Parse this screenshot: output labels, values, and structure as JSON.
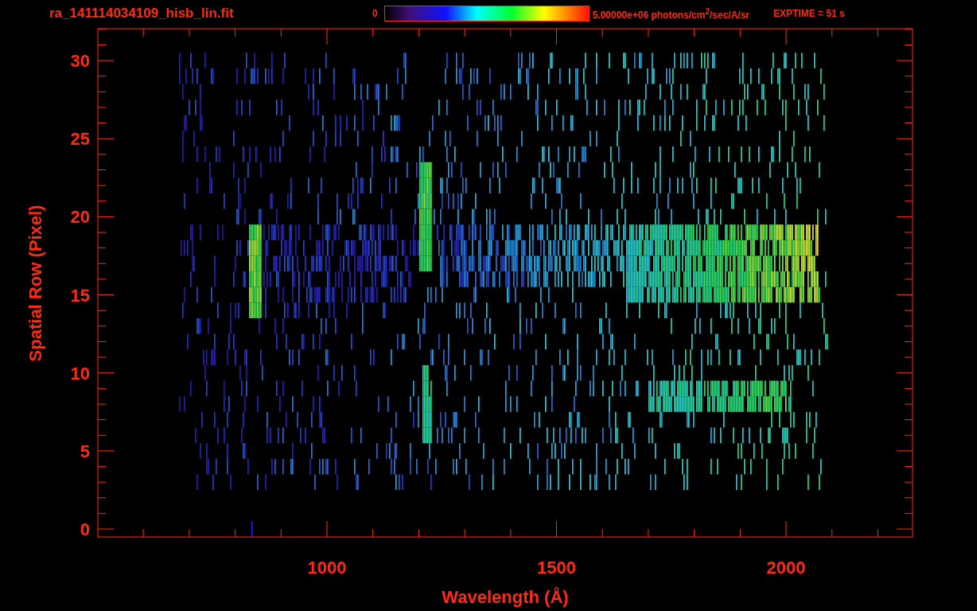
{
  "title": "ra_141114034109_hisb_lin.fit",
  "colorbar": {
    "min_label": "0",
    "max_label": "5.00000e+06 photons/cm$^{2}$/sec/A/sr"
  },
  "exposure": "EXPTIME = 51 s",
  "plot": {
    "xlabel": "Wavelength (Å)",
    "ylabel": "Spatial Row (Pixel)",
    "yticks": [
      "30",
      "25",
      "20",
      "15",
      "10",
      "5",
      "0"
    ],
    "xticks": [
      "1000",
      "1500",
      "2000"
    ]
  }
}
